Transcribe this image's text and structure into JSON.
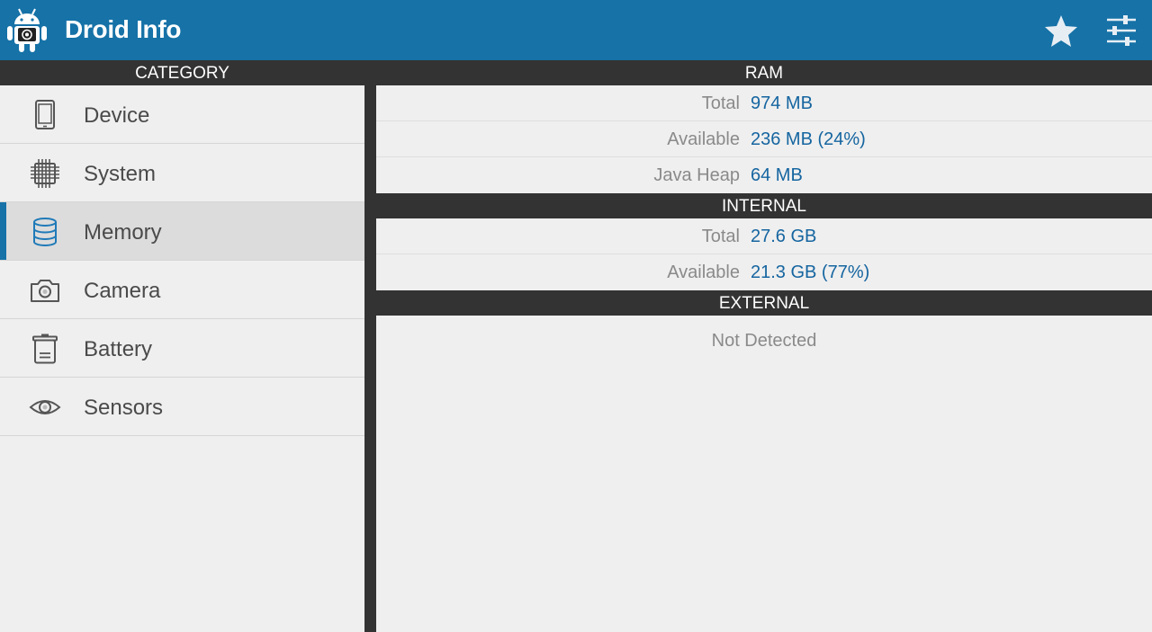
{
  "app": {
    "title": "Droid Info",
    "brand_color": "#1672a7",
    "header_color": "#333333"
  },
  "toolbar": {
    "actions": [
      {
        "icon": "star-icon"
      },
      {
        "icon": "settings-sliders-icon"
      }
    ]
  },
  "sidebar": {
    "header": "CATEGORY",
    "active": "Memory",
    "items": [
      {
        "label": "Device",
        "icon": "phone-icon"
      },
      {
        "label": "System",
        "icon": "cpu-chip-icon"
      },
      {
        "label": "Memory",
        "icon": "database-icon"
      },
      {
        "label": "Camera",
        "icon": "camera-icon"
      },
      {
        "label": "Battery",
        "icon": "battery-icon"
      },
      {
        "label": "Sensors",
        "icon": "eye-icon"
      }
    ]
  },
  "main": {
    "sections": [
      {
        "header": "RAM",
        "rows": [
          {
            "label": "Total",
            "value": "974 MB"
          },
          {
            "label": "Available",
            "value": "236 MB (24%)"
          },
          {
            "label": "Java Heap",
            "value": "64 MB"
          }
        ]
      },
      {
        "header": "INTERNAL",
        "rows": [
          {
            "label": "Total",
            "value": "27.6 GB"
          },
          {
            "label": "Available",
            "value": "21.3 GB (77%)"
          }
        ]
      },
      {
        "header": "EXTERNAL",
        "message": "Not Detected"
      }
    ]
  }
}
